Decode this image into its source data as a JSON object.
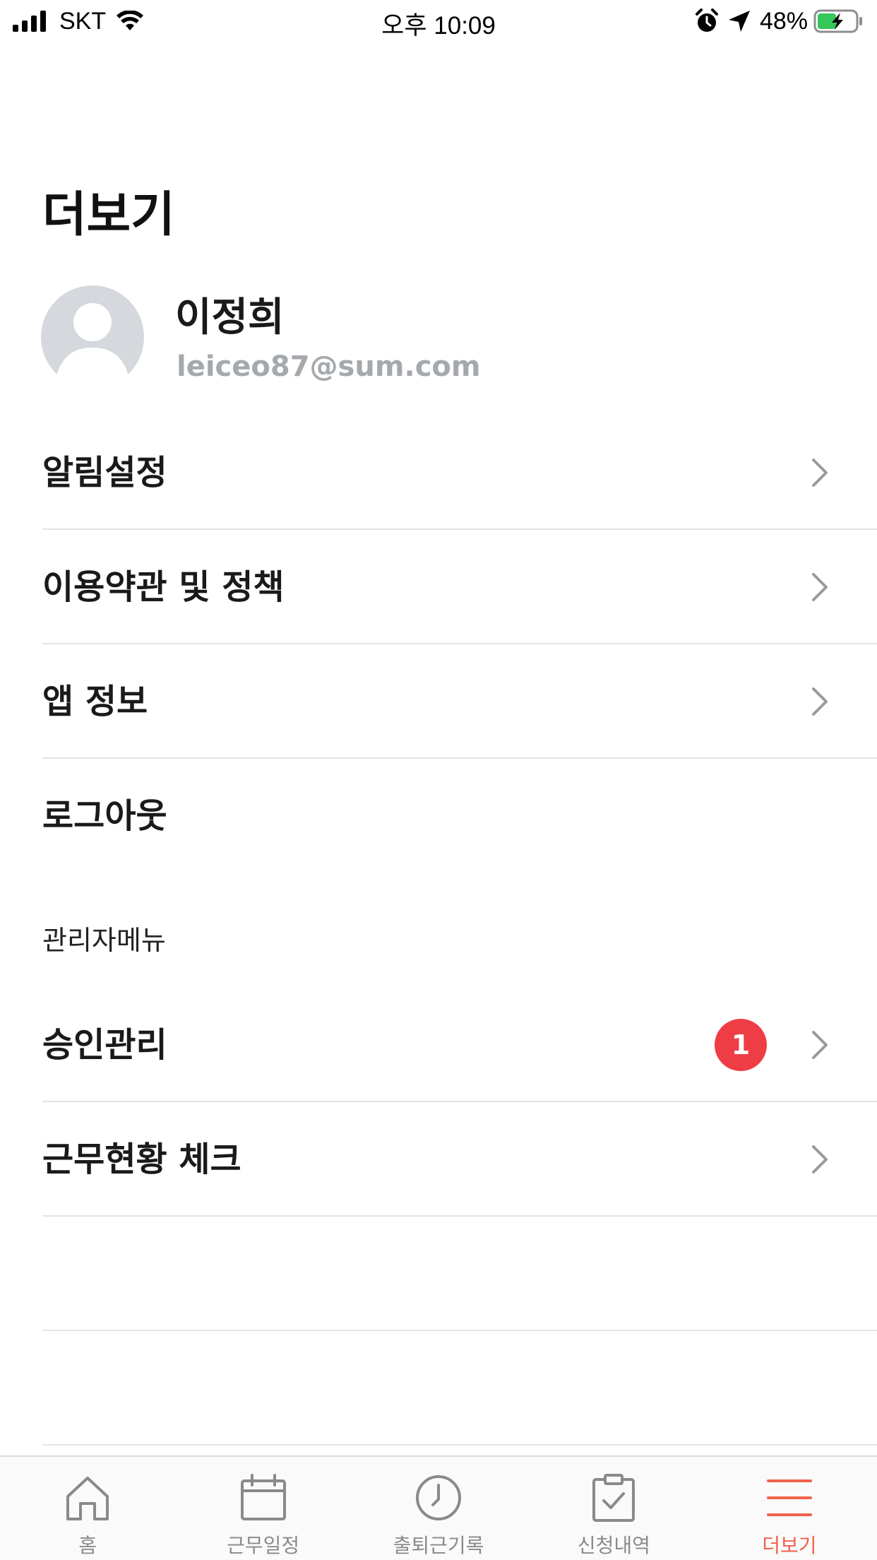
{
  "status_bar": {
    "carrier": "SKT",
    "time": "오후 10:09",
    "battery_percent": "48%"
  },
  "page": {
    "title": "더보기"
  },
  "profile": {
    "name": "이정희",
    "email": "leiceo87@sum.com"
  },
  "menu": {
    "items": [
      {
        "label": "알림설정"
      },
      {
        "label": "이용약관 및 정책"
      },
      {
        "label": "앱 정보"
      },
      {
        "label": "로그아웃"
      }
    ]
  },
  "admin": {
    "section_label": "관리자메뉴",
    "items": [
      {
        "label": "승인관리",
        "badge": "1"
      },
      {
        "label": "근무현황 체크"
      }
    ]
  },
  "tab_bar": {
    "tabs": [
      {
        "label": "홈",
        "icon": "home-icon"
      },
      {
        "label": "근무일정",
        "icon": "calendar-icon"
      },
      {
        "label": "출퇴근기록",
        "icon": "clock-icon"
      },
      {
        "label": "신청내역",
        "icon": "clipboard-check-icon"
      },
      {
        "label": "더보기",
        "icon": "menu-icon",
        "active": true
      }
    ]
  },
  "colors": {
    "accent": "#f0624b",
    "badge": "#ef3d45",
    "divider": "#e3e3e3",
    "email_text": "#a5a9ad",
    "battery_fill": "#35c759"
  }
}
